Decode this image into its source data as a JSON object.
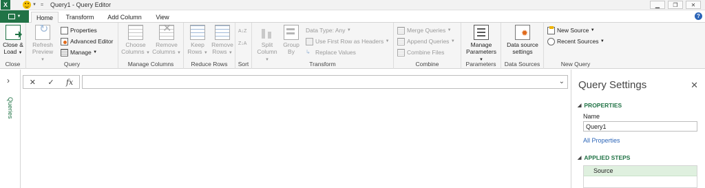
{
  "window": {
    "title": "Query1 - Query Editor",
    "logo": "X",
    "qat_customize": "="
  },
  "tabs": [
    {
      "label": "Home",
      "active": true
    },
    {
      "label": "Transform",
      "active": false
    },
    {
      "label": "Add Column",
      "active": false
    },
    {
      "label": "View",
      "active": false
    }
  ],
  "ribbon": {
    "close": {
      "btn_line1": "Close &",
      "btn_line2": "Load",
      "label": "Close"
    },
    "query": {
      "refresh_line1": "Refresh",
      "refresh_line2": "Preview",
      "properties": "Properties",
      "advanced_editor": "Advanced Editor",
      "manage": "Manage",
      "label": "Query"
    },
    "manage_columns": {
      "choose_line1": "Choose",
      "choose_line2": "Columns",
      "remove_line1": "Remove",
      "remove_line2": "Columns",
      "label": "Manage Columns"
    },
    "reduce_rows": {
      "keep_line1": "Keep",
      "keep_line2": "Rows",
      "remove_line1": "Remove",
      "remove_line2": "Rows",
      "label": "Reduce Rows"
    },
    "sort": {
      "asc": "A↓Z",
      "desc": "Z↓A",
      "label": "Sort"
    },
    "transform": {
      "split_line1": "Split",
      "split_line2": "Column",
      "group_line1": "Group",
      "group_line2": "By",
      "data_type": "Data Type: Any",
      "first_row": "Use First Row as Headers",
      "replace": "Replace Values",
      "label": "Transform"
    },
    "combine": {
      "merge": "Merge Queries",
      "append": "Append Queries",
      "combine_files": "Combine Files",
      "label": "Combine"
    },
    "parameters": {
      "manage_line1": "Manage",
      "manage_line2": "Parameters",
      "label": "Parameters"
    },
    "data_sources": {
      "btn_line1": "Data source",
      "btn_line2": "settings",
      "label": "Data Sources"
    },
    "new_query": {
      "new_source": "New Source",
      "recent_sources": "Recent Sources",
      "label": "New Query"
    }
  },
  "left_pane": {
    "label": "Queries"
  },
  "formula_bar": {
    "cancel": "✕",
    "commit": "✓",
    "fx": "fx"
  },
  "settings": {
    "title": "Query Settings",
    "properties_header": "PROPERTIES",
    "name_label": "Name",
    "name_value": "Query1",
    "all_properties": "All Properties",
    "applied_steps_header": "APPLIED STEPS",
    "steps": [
      "Source"
    ]
  }
}
